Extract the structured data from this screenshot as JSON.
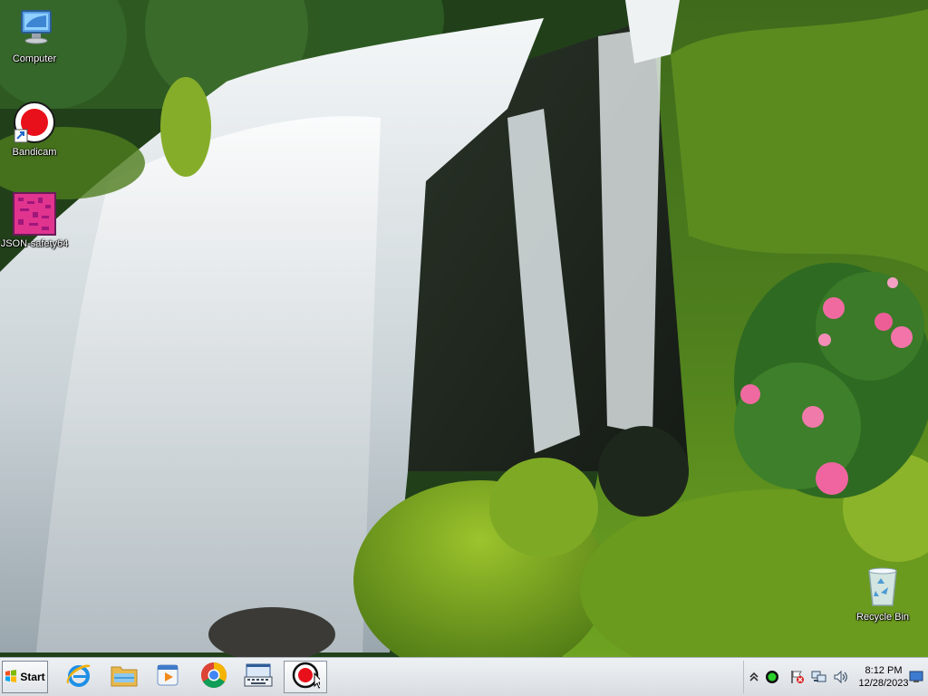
{
  "desktop": {
    "icons": [
      {
        "label": "Computer",
        "icon": "computer-icon"
      },
      {
        "label": "Bandicam",
        "icon": "bandicam-icon"
      },
      {
        "label": "JSON-safety64",
        "icon": "json-file-icon"
      },
      {
        "label": "Recycle Bin",
        "icon": "recycle-bin-icon"
      }
    ]
  },
  "taskbar": {
    "start_label": "Start",
    "pinned": [
      {
        "icon": "internet-explorer-icon"
      },
      {
        "icon": "file-explorer-icon"
      },
      {
        "icon": "media-player-icon"
      },
      {
        "icon": "chrome-icon"
      },
      {
        "icon": "on-screen-keyboard-icon"
      },
      {
        "icon": "bandicam-icon",
        "active": true
      }
    ],
    "tray": {
      "icons": [
        "show-hidden-icons-chevron",
        "bandicam-status-icon",
        "action-center-flag-icon",
        "network-icon",
        "volume-icon"
      ],
      "time": "8:12 PM",
      "date": "12/28/2023"
    }
  },
  "colors": {
    "bandicam_red": "#e8101a",
    "taskbar_bg": "#e3e6ea"
  }
}
